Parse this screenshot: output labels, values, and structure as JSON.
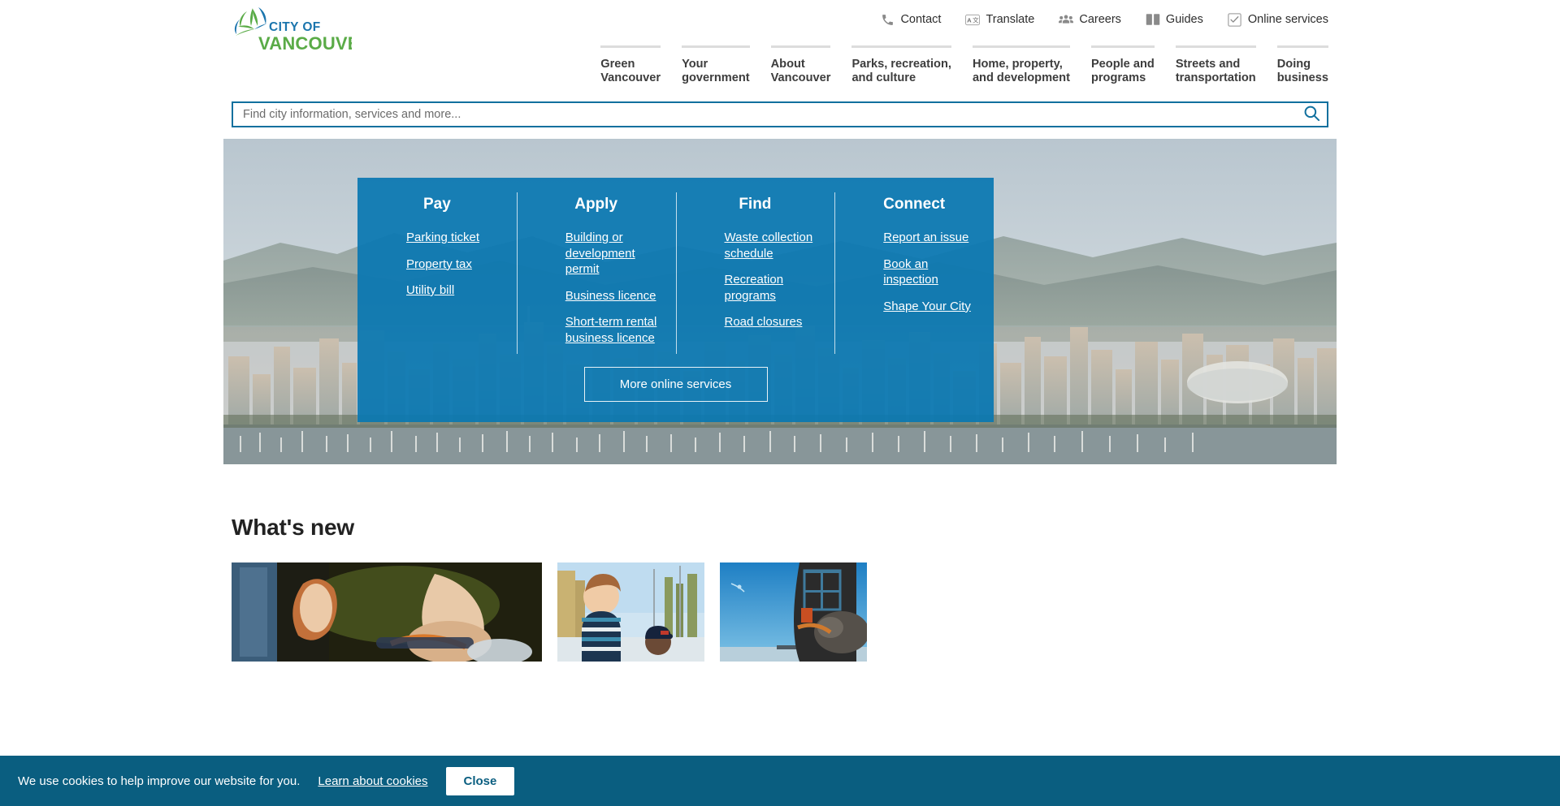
{
  "site": {
    "logo_line1": "CITY OF",
    "logo_line2": "VANCOUVER"
  },
  "utility_nav": [
    {
      "label": "Contact",
      "icon": "phone-icon"
    },
    {
      "label": "Translate",
      "icon": "translate-icon"
    },
    {
      "label": "Careers",
      "icon": "people-icon"
    },
    {
      "label": "Guides",
      "icon": "book-icon"
    },
    {
      "label": "Online services",
      "icon": "checkbox-tablet-icon"
    }
  ],
  "main_nav": [
    {
      "label": "Green\nVancouver"
    },
    {
      "label": "Your\ngovernment"
    },
    {
      "label": "About\nVancouver"
    },
    {
      "label": "Parks, recreation,\nand culture"
    },
    {
      "label": "Home, property,\nand development"
    },
    {
      "label": "People and\nprograms"
    },
    {
      "label": "Streets and\ntransportation"
    },
    {
      "label": "Doing\nbusiness"
    }
  ],
  "search": {
    "placeholder": "Find city information, services and more...",
    "value": "",
    "icon": "search-icon"
  },
  "hero": {
    "columns": [
      {
        "title": "Pay",
        "links": [
          "Parking ticket",
          "Property tax",
          "Utility bill"
        ]
      },
      {
        "title": "Apply",
        "links": [
          "Building or development permit",
          "Business licence",
          "Short-term rental business licence"
        ]
      },
      {
        "title": "Find",
        "links": [
          "Waste collection schedule",
          "Recreation programs",
          "Road closures"
        ]
      },
      {
        "title": "Connect",
        "links": [
          "Report an issue",
          "Book an inspection",
          "Shape Your City"
        ]
      }
    ],
    "more_button": "More online services"
  },
  "whats_new": {
    "title": "What's new",
    "cards": [
      {
        "image_alt": "person-cycling-outdoors"
      },
      {
        "image_alt": "child-in-striped-sweater-outdoors"
      },
      {
        "image_alt": "construction-equipment-blue-sky"
      }
    ]
  },
  "cookie_banner": {
    "message": "We use cookies to help improve our website for you.",
    "link": "Learn about cookies",
    "close_label": "Close"
  },
  "colors": {
    "brand_blue": "#0a77b2",
    "search_border": "#11709e",
    "cookie_bg": "#0a5e80",
    "logo_green": "#5aab47",
    "logo_blue": "#1b75ad",
    "nav_border": "#dcdcdc"
  }
}
